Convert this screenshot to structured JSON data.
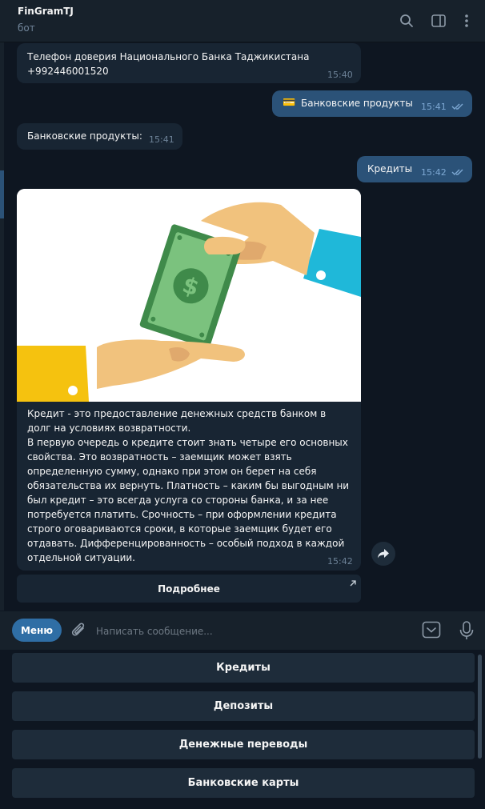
{
  "header": {
    "title": "FinGramTJ",
    "subtitle": "бот"
  },
  "messages": {
    "m1": {
      "text_line1": "Телефон доверия Национального Банка Таджикистана",
      "text_line2": "+992446001520",
      "time": "15:40"
    },
    "m2": {
      "emoji": "💳",
      "text": "Банковские продукты",
      "time": "15:41"
    },
    "m3": {
      "text": "Банковские продукты:",
      "time": "15:41"
    },
    "m4": {
      "text": "Кредиты",
      "time": "15:42"
    },
    "m5": {
      "caption_p1": "Кредит - это предоставление денежных средств банком в долг на условиях возвратности.",
      "caption_p2": "В первую очередь о кредите стоит знать четыре его основных свойства. Это возвратность – заемщик может взять определенную сумму, однако при этом он берет на себя обязательства их вернуть. Платность – каким бы выгодным ни был кредит – это всегда услуга со стороны банка, и за нее потребуется платить. Срочность – при оформлении кредита строго оговариваются сроки, в которые заемщик будет его отдавать. Дифференцированность – особый подход в каждой отдельной ситуации.",
      "time": "15:42",
      "inline_button": "Подробнее"
    }
  },
  "input": {
    "menu_label": "Меню",
    "placeholder": "Написать сообщение..."
  },
  "keyboard": {
    "buttons": [
      "Кредиты",
      "Депозиты",
      "Денежные переводы",
      "Банковские карты"
    ]
  },
  "icons": {
    "search": "search-icon",
    "sidebar": "sidebar-toggle-icon",
    "more": "more-vertical-icon",
    "attach": "paperclip-icon",
    "keyboard": "bot-keyboard-icon",
    "mic": "microphone-icon",
    "forward": "forward-icon",
    "checks": "double-check-icon"
  },
  "colors": {
    "accent": "#2b5278",
    "background": "#0e1621",
    "panel": "#17212b",
    "incoming": "#182533"
  }
}
